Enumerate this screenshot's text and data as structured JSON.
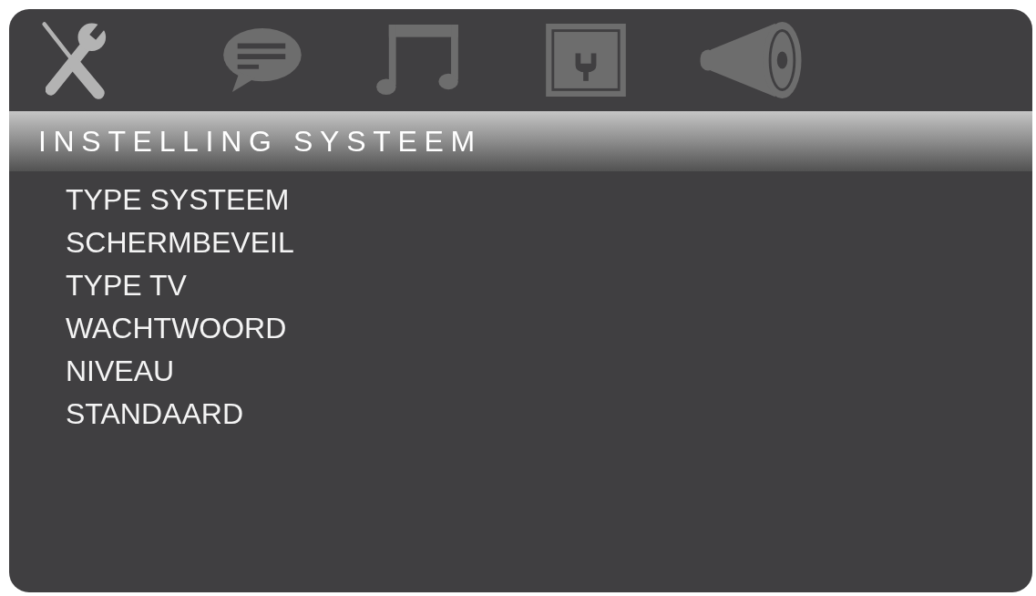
{
  "tabs": [
    {
      "kind": "tools",
      "selected": true
    },
    {
      "kind": "chat",
      "selected": false
    },
    {
      "kind": "music",
      "selected": false
    },
    {
      "kind": "screen",
      "selected": false
    },
    {
      "kind": "megaphone",
      "selected": false
    }
  ],
  "section_title": "INSTELLING SYSTEEM",
  "menu_items": [
    "TYPE SYSTEEM",
    "SCHERMBEVEIL",
    "TYPE TV",
    "WACHTWOORD",
    "NIVEAU",
    "STANDAARD"
  ]
}
